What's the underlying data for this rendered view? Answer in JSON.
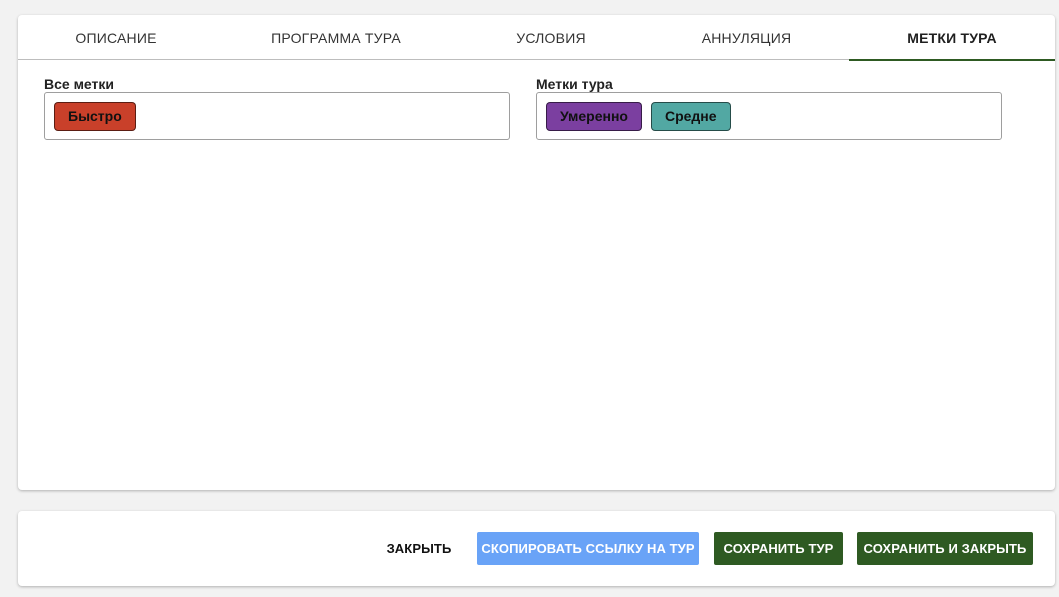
{
  "tabs": [
    {
      "label": "ОПИСАНИЕ",
      "active": false
    },
    {
      "label": "ПРОГРАММА ТУРА",
      "active": false
    },
    {
      "label": "УСЛОВИЯ",
      "active": false
    },
    {
      "label": "АННУЛЯЦИЯ",
      "active": false
    },
    {
      "label": "МЕТКИ ТУРА",
      "active": true
    }
  ],
  "all_tags": {
    "label": "Все метки",
    "items": [
      {
        "label": "Быстро",
        "color": "#c9402a"
      }
    ]
  },
  "tour_tags": {
    "label": "Метки тура",
    "items": [
      {
        "label": "Умеренно",
        "color": "#7b3fa0"
      },
      {
        "label": "Средне",
        "color": "#52a8a3"
      }
    ]
  },
  "footer": {
    "close_label": "ЗАКРЫТЬ",
    "copy_link_label": "СКОПИРОВАТЬ ССЫЛКУ НА ТУР",
    "save_label": "СОХРАНИТЬ ТУР",
    "save_close_label": "СОХРАНИТЬ И ЗАКРЫТЬ"
  },
  "colors": {
    "accent_green": "#2e5a22",
    "copy_button_blue": "#69a3f7",
    "active_tab_underline": "#2e5a22"
  }
}
